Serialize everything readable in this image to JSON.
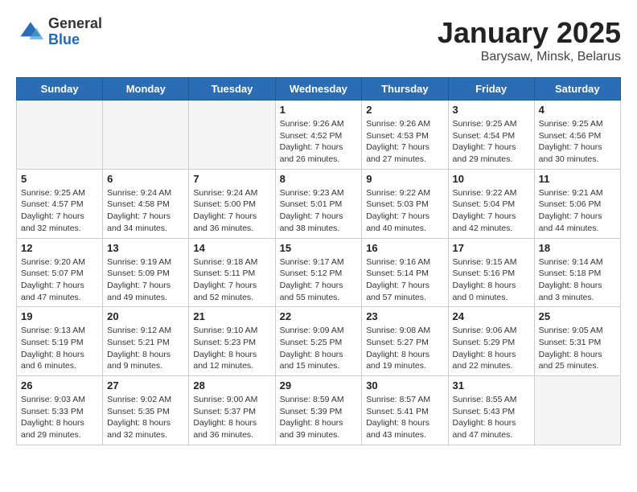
{
  "header": {
    "logo_general": "General",
    "logo_blue": "Blue",
    "title": "January 2025",
    "subtitle": "Barysaw, Minsk, Belarus"
  },
  "weekdays": [
    "Sunday",
    "Monday",
    "Tuesday",
    "Wednesday",
    "Thursday",
    "Friday",
    "Saturday"
  ],
  "weeks": [
    [
      {
        "day": "",
        "info": ""
      },
      {
        "day": "",
        "info": ""
      },
      {
        "day": "",
        "info": ""
      },
      {
        "day": "1",
        "info": "Sunrise: 9:26 AM\nSunset: 4:52 PM\nDaylight: 7 hours and 26 minutes."
      },
      {
        "day": "2",
        "info": "Sunrise: 9:26 AM\nSunset: 4:53 PM\nDaylight: 7 hours and 27 minutes."
      },
      {
        "day": "3",
        "info": "Sunrise: 9:25 AM\nSunset: 4:54 PM\nDaylight: 7 hours and 29 minutes."
      },
      {
        "day": "4",
        "info": "Sunrise: 9:25 AM\nSunset: 4:56 PM\nDaylight: 7 hours and 30 minutes."
      }
    ],
    [
      {
        "day": "5",
        "info": "Sunrise: 9:25 AM\nSunset: 4:57 PM\nDaylight: 7 hours and 32 minutes."
      },
      {
        "day": "6",
        "info": "Sunrise: 9:24 AM\nSunset: 4:58 PM\nDaylight: 7 hours and 34 minutes."
      },
      {
        "day": "7",
        "info": "Sunrise: 9:24 AM\nSunset: 5:00 PM\nDaylight: 7 hours and 36 minutes."
      },
      {
        "day": "8",
        "info": "Sunrise: 9:23 AM\nSunset: 5:01 PM\nDaylight: 7 hours and 38 minutes."
      },
      {
        "day": "9",
        "info": "Sunrise: 9:22 AM\nSunset: 5:03 PM\nDaylight: 7 hours and 40 minutes."
      },
      {
        "day": "10",
        "info": "Sunrise: 9:22 AM\nSunset: 5:04 PM\nDaylight: 7 hours and 42 minutes."
      },
      {
        "day": "11",
        "info": "Sunrise: 9:21 AM\nSunset: 5:06 PM\nDaylight: 7 hours and 44 minutes."
      }
    ],
    [
      {
        "day": "12",
        "info": "Sunrise: 9:20 AM\nSunset: 5:07 PM\nDaylight: 7 hours and 47 minutes."
      },
      {
        "day": "13",
        "info": "Sunrise: 9:19 AM\nSunset: 5:09 PM\nDaylight: 7 hours and 49 minutes."
      },
      {
        "day": "14",
        "info": "Sunrise: 9:18 AM\nSunset: 5:11 PM\nDaylight: 7 hours and 52 minutes."
      },
      {
        "day": "15",
        "info": "Sunrise: 9:17 AM\nSunset: 5:12 PM\nDaylight: 7 hours and 55 minutes."
      },
      {
        "day": "16",
        "info": "Sunrise: 9:16 AM\nSunset: 5:14 PM\nDaylight: 7 hours and 57 minutes."
      },
      {
        "day": "17",
        "info": "Sunrise: 9:15 AM\nSunset: 5:16 PM\nDaylight: 8 hours and 0 minutes."
      },
      {
        "day": "18",
        "info": "Sunrise: 9:14 AM\nSunset: 5:18 PM\nDaylight: 8 hours and 3 minutes."
      }
    ],
    [
      {
        "day": "19",
        "info": "Sunrise: 9:13 AM\nSunset: 5:19 PM\nDaylight: 8 hours and 6 minutes."
      },
      {
        "day": "20",
        "info": "Sunrise: 9:12 AM\nSunset: 5:21 PM\nDaylight: 8 hours and 9 minutes."
      },
      {
        "day": "21",
        "info": "Sunrise: 9:10 AM\nSunset: 5:23 PM\nDaylight: 8 hours and 12 minutes."
      },
      {
        "day": "22",
        "info": "Sunrise: 9:09 AM\nSunset: 5:25 PM\nDaylight: 8 hours and 15 minutes."
      },
      {
        "day": "23",
        "info": "Sunrise: 9:08 AM\nSunset: 5:27 PM\nDaylight: 8 hours and 19 minutes."
      },
      {
        "day": "24",
        "info": "Sunrise: 9:06 AM\nSunset: 5:29 PM\nDaylight: 8 hours and 22 minutes."
      },
      {
        "day": "25",
        "info": "Sunrise: 9:05 AM\nSunset: 5:31 PM\nDaylight: 8 hours and 25 minutes."
      }
    ],
    [
      {
        "day": "26",
        "info": "Sunrise: 9:03 AM\nSunset: 5:33 PM\nDaylight: 8 hours and 29 minutes."
      },
      {
        "day": "27",
        "info": "Sunrise: 9:02 AM\nSunset: 5:35 PM\nDaylight: 8 hours and 32 minutes."
      },
      {
        "day": "28",
        "info": "Sunrise: 9:00 AM\nSunset: 5:37 PM\nDaylight: 8 hours and 36 minutes."
      },
      {
        "day": "29",
        "info": "Sunrise: 8:59 AM\nSunset: 5:39 PM\nDaylight: 8 hours and 39 minutes."
      },
      {
        "day": "30",
        "info": "Sunrise: 8:57 AM\nSunset: 5:41 PM\nDaylight: 8 hours and 43 minutes."
      },
      {
        "day": "31",
        "info": "Sunrise: 8:55 AM\nSunset: 5:43 PM\nDaylight: 8 hours and 47 minutes."
      },
      {
        "day": "",
        "info": ""
      }
    ]
  ]
}
